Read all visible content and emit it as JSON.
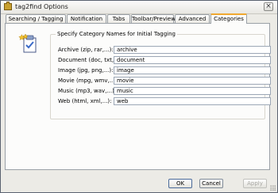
{
  "window": {
    "title": "tag2find Options"
  },
  "tabs": [
    {
      "label": "Searching / Tagging"
    },
    {
      "label": "Notification"
    },
    {
      "label": "Tabs"
    },
    {
      "label": "Toolbar/Preview"
    },
    {
      "label": "Advanced"
    },
    {
      "label": "Categories",
      "active": true
    }
  ],
  "categories": {
    "group_title": "Specify Category Names for Initial Tagging",
    "rows": [
      {
        "label": "Archive (zip, rar,...):",
        "value": "archive"
      },
      {
        "label": "Document (doc, txt,...):",
        "value": "document"
      },
      {
        "label": "Image (jpg, png,...):",
        "value": "image"
      },
      {
        "label": "Movie (mpg, wmv,...):",
        "value": "movie"
      },
      {
        "label": "Music (mp3, wav,...):",
        "value": "music"
      },
      {
        "label": "Web (html, xml,...):",
        "value": "web"
      }
    ]
  },
  "buttons": {
    "ok": "OK",
    "cancel": "Cancel",
    "apply": "Apply"
  },
  "icons": {
    "app": "folder-icon",
    "category": "checklist-icon",
    "close": "close-icon"
  }
}
